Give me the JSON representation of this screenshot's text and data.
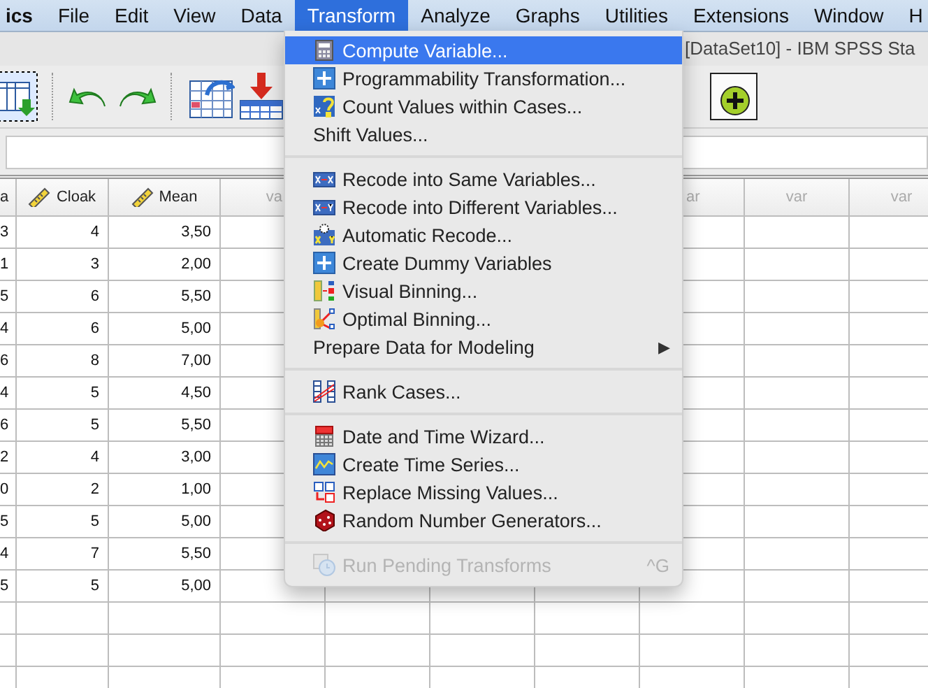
{
  "menubar": {
    "items": [
      {
        "label": "ics",
        "selected": false,
        "kind": "app"
      },
      {
        "label": "File",
        "selected": false
      },
      {
        "label": "Edit",
        "selected": false
      },
      {
        "label": "View",
        "selected": false
      },
      {
        "label": "Data",
        "selected": false
      },
      {
        "label": "Transform",
        "selected": true
      },
      {
        "label": "Analyze",
        "selected": false
      },
      {
        "label": "Graphs",
        "selected": false
      },
      {
        "label": "Utilities",
        "selected": false
      },
      {
        "label": "Extensions",
        "selected": false
      },
      {
        "label": "Window",
        "selected": false
      },
      {
        "label": "H",
        "selected": false
      }
    ]
  },
  "window": {
    "title": "[DataSet10] - IBM SPSS Sta"
  },
  "grid": {
    "columns": [
      {
        "header": "a",
        "kind": "variable"
      },
      {
        "header": "Cloak",
        "kind": "scale"
      },
      {
        "header": "Mean",
        "kind": "scale"
      },
      {
        "header": "va",
        "kind": "empty"
      },
      {
        "kind": "empty"
      },
      {
        "kind": "empty"
      },
      {
        "kind": "empty"
      },
      {
        "header": "ar",
        "kind": "empty"
      },
      {
        "header": "var",
        "kind": "empty"
      },
      {
        "header": "var",
        "kind": "empty"
      }
    ],
    "rows": [
      [
        "3",
        "4",
        "3,50"
      ],
      [
        "1",
        "3",
        "2,00"
      ],
      [
        "5",
        "6",
        "5,50"
      ],
      [
        "4",
        "6",
        "5,00"
      ],
      [
        "6",
        "8",
        "7,00"
      ],
      [
        "4",
        "5",
        "4,50"
      ],
      [
        "6",
        "5",
        "5,50"
      ],
      [
        "2",
        "4",
        "3,00"
      ],
      [
        "0",
        "2",
        "1,00"
      ],
      [
        "5",
        "5",
        "5,00"
      ],
      [
        "4",
        "7",
        "5,50"
      ],
      [
        "5",
        "5",
        "5,00"
      ]
    ]
  },
  "menu": {
    "items": [
      {
        "kind": "item",
        "label": "Compute Variable...",
        "selected": true,
        "disabled": false
      },
      {
        "kind": "item",
        "label": "Programmability Transformation...",
        "selected": false,
        "disabled": false
      },
      {
        "kind": "item",
        "label": "Count Values within Cases...",
        "selected": false,
        "disabled": false
      },
      {
        "kind": "item",
        "label": "Shift Values...",
        "selected": false,
        "disabled": false
      },
      {
        "kind": "separator"
      },
      {
        "kind": "item",
        "label": "Recode into Same Variables...",
        "selected": false,
        "disabled": false
      },
      {
        "kind": "item",
        "label": "Recode into Different Variables...",
        "selected": false,
        "disabled": false
      },
      {
        "kind": "item",
        "label": "Automatic Recode...",
        "selected": false,
        "disabled": false
      },
      {
        "kind": "item",
        "label": "Create Dummy Variables",
        "selected": false,
        "disabled": false
      },
      {
        "kind": "item",
        "label": "Visual Binning...",
        "selected": false,
        "disabled": false
      },
      {
        "kind": "item",
        "label": "Optimal Binning...",
        "selected": false,
        "disabled": false
      },
      {
        "kind": "item",
        "label": "Prepare Data for Modeling",
        "selected": false,
        "disabled": false,
        "submenu_arrow": "▶"
      },
      {
        "kind": "separator"
      },
      {
        "kind": "item",
        "label": "Rank Cases...",
        "selected": false,
        "disabled": false
      },
      {
        "kind": "separator"
      },
      {
        "kind": "item",
        "label": "Date and Time Wizard...",
        "selected": false,
        "disabled": false
      },
      {
        "kind": "item",
        "label": "Create Time Series...",
        "selected": false,
        "disabled": false
      },
      {
        "kind": "item",
        "label": "Replace Missing Values...",
        "selected": false,
        "disabled": false
      },
      {
        "kind": "item",
        "label": "Random Number Generators...",
        "selected": false,
        "disabled": false
      },
      {
        "kind": "separator"
      },
      {
        "kind": "item",
        "label": "Run Pending Transforms",
        "selected": false,
        "disabled": true,
        "shortcut": "^G"
      }
    ]
  }
}
